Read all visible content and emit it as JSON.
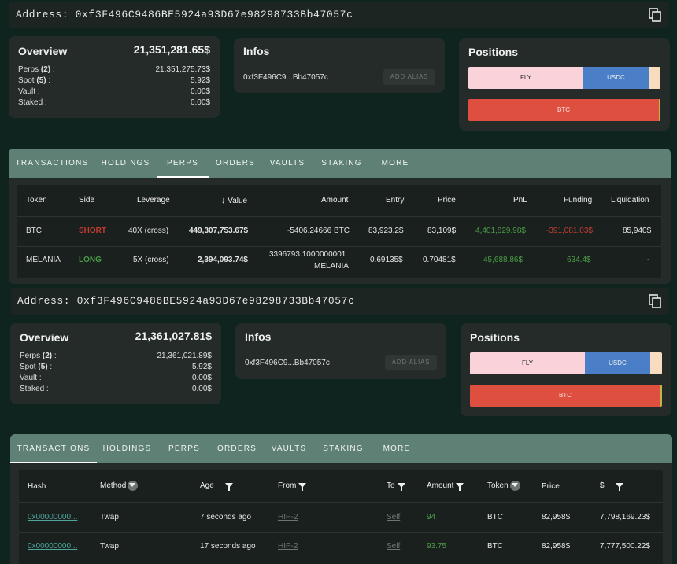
{
  "block1": {
    "address": "Address: 0xf3F496C9486BE5924a93D67e98298733Bb47057c",
    "overview": {
      "title": "Overview",
      "total": "21,351,281.65$",
      "rows": [
        {
          "label_prefix": "Perps ",
          "label_count": "(2)",
          "label_suffix": " :",
          "value": "21,351,275.73$"
        },
        {
          "label_prefix": "Spot ",
          "label_count": "(5)",
          "label_suffix": " :",
          "value": "5.92$"
        },
        {
          "label_prefix": "Vault :",
          "label_count": "",
          "label_suffix": "",
          "value": "0.00$"
        },
        {
          "label_prefix": "Staked :",
          "label_count": "",
          "label_suffix": "",
          "value": "0.00$"
        }
      ]
    },
    "infos": {
      "title": "Infos",
      "address_short": "0xf3F496C9...Bb47057c",
      "alias_button": "ADD ALIAS"
    },
    "positions": {
      "title": "Positions",
      "bar1": [
        "FLY",
        "USDC"
      ],
      "bar2": [
        "BTC"
      ]
    },
    "tabs": [
      "TRANSACTIONS",
      "HOLDINGS",
      "PERPS",
      "ORDERS",
      "VAULTS",
      "STAKING",
      "MORE"
    ],
    "active_tab": "PERPS",
    "perps_table": {
      "headers": [
        "Token",
        "Side",
        "Leverage",
        "Value",
        "Amount",
        "Entry",
        "Price",
        "PnL",
        "Funding",
        "Liquidation"
      ],
      "rows": [
        {
          "token": "BTC",
          "side": "SHORT",
          "leverage": "40X (cross)",
          "value": "449,307,753.67$",
          "amount": "-5406.24666 BTC",
          "entry": "83,923.2$",
          "price": "83,109$",
          "pnl": "4,401,829.98$",
          "funding": "-391,081.03$",
          "liquidation": "85,940$"
        },
        {
          "token": "MELANIA",
          "side": "LONG",
          "leverage": "5X (cross)",
          "value": "2,394,093.74$",
          "amount_line1": "3396793.1000000001",
          "amount_line2": "MELANIA",
          "entry": "0.69135$",
          "price": "0.70481$",
          "pnl": "45,688.86$",
          "funding": "634.4$",
          "liquidation": "-"
        }
      ]
    }
  },
  "block2": {
    "address": "Address: 0xf3F496C9486BE5924a93D67e98298733Bb47057c",
    "overview": {
      "title": "Overview",
      "total": "21,361,027.81$",
      "rows": [
        {
          "label_prefix": "Perps ",
          "label_count": "(2)",
          "label_suffix": " :",
          "value": "21,361,021.89$"
        },
        {
          "label_prefix": "Spot ",
          "label_count": "(5)",
          "label_suffix": " :",
          "value": "5.92$"
        },
        {
          "label_prefix": "Vault :",
          "label_count": "",
          "label_suffix": "",
          "value": "0.00$"
        },
        {
          "label_prefix": "Staked :",
          "label_count": "",
          "label_suffix": "",
          "value": "0.00$"
        }
      ]
    },
    "infos": {
      "title": "Infos",
      "address_short": "0xf3F496C9...Bb47057c",
      "alias_button": "ADD ALIAS"
    },
    "positions": {
      "title": "Positions",
      "bar1": [
        "FLY",
        "USDC"
      ],
      "bar2": [
        "BTC"
      ]
    },
    "tabs": [
      "TRANSACTIONS",
      "HOLDINGS",
      "PERPS",
      "ORDERS",
      "VAULTS",
      "STAKING",
      "MORE"
    ],
    "active_tab": "TRANSACTIONS",
    "tx_table": {
      "headers": [
        "Hash",
        "Method",
        "Age",
        "From",
        "To",
        "Amount",
        "Token",
        "Price",
        "$"
      ],
      "rows": [
        {
          "hash": "0x00000000...",
          "method": "Twap",
          "age": "7 seconds ago",
          "from": "HIP-2",
          "to": "Self",
          "amount": "94",
          "token": "BTC",
          "price": "82,958$",
          "usd": "7,798,169.23$"
        },
        {
          "hash": "0x00000000...",
          "method": "Twap",
          "age": "17 seconds ago",
          "from": "HIP-2",
          "to": "Self",
          "amount": "93.75",
          "token": "BTC",
          "price": "82,958$",
          "usd": "7,777,500.22$"
        }
      ]
    }
  },
  "colors": {
    "background": "#0f231f",
    "card": "#252b29",
    "tabbar": "#5e8075",
    "fly": "#f9d2da",
    "usdc": "#4a7ec6",
    "btc": "#df4f3f",
    "green": "#4a9a46",
    "red": "#c43c33"
  },
  "icons": [
    "copy-icon",
    "sort-down-arrow-icon",
    "filter-icon"
  ]
}
